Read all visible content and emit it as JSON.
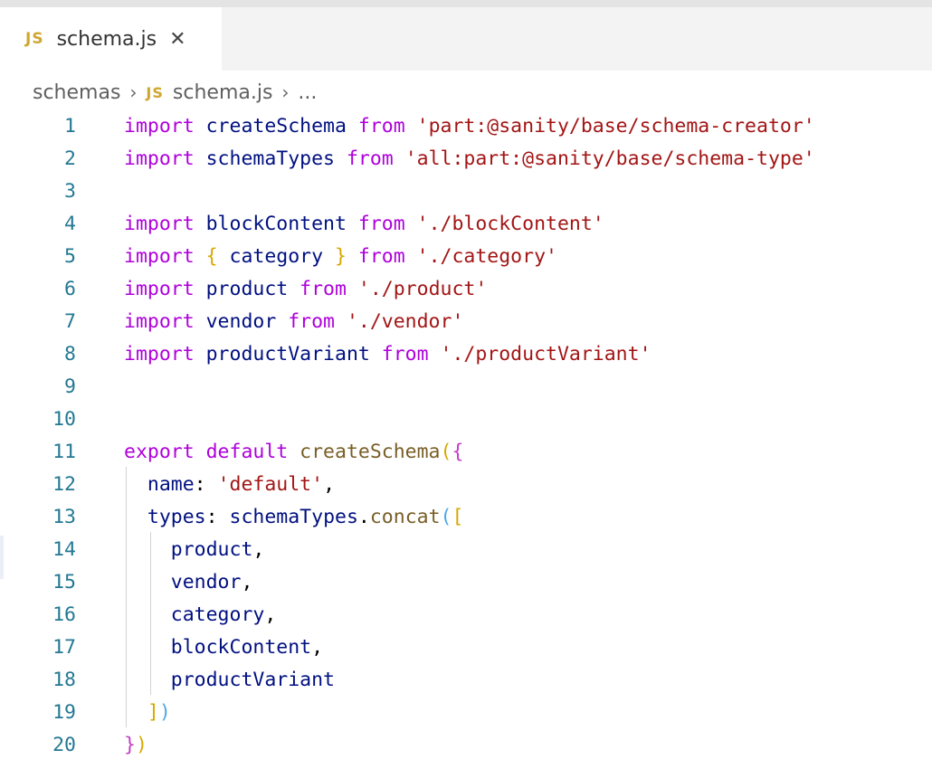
{
  "tab": {
    "badge": "JS",
    "filename": "schema.js",
    "close": "✕"
  },
  "breadcrumb": {
    "folder": "schemas",
    "sep1": "›",
    "badge": "JS",
    "file": "schema.js",
    "sep2": "›",
    "more": "..."
  },
  "lines": [
    {
      "n": "1",
      "t": [
        [
          "kw",
          "import "
        ],
        [
          "id",
          "createSchema "
        ],
        [
          "kw",
          "from "
        ],
        [
          "str",
          "'part:@sanity/base/schema-creator'"
        ]
      ]
    },
    {
      "n": "2",
      "t": [
        [
          "kw",
          "import "
        ],
        [
          "id",
          "schemaTypes "
        ],
        [
          "kw",
          "from "
        ],
        [
          "str",
          "'all:part:@sanity/base/schema-type'"
        ]
      ]
    },
    {
      "n": "3",
      "t": []
    },
    {
      "n": "4",
      "t": [
        [
          "kw",
          "import "
        ],
        [
          "id",
          "blockContent "
        ],
        [
          "kw",
          "from "
        ],
        [
          "str",
          "'./blockContent'"
        ]
      ]
    },
    {
      "n": "5",
      "t": [
        [
          "kw",
          "import "
        ],
        [
          "b1",
          "{ "
        ],
        [
          "id",
          "category "
        ],
        [
          "b1",
          "} "
        ],
        [
          "kw",
          "from "
        ],
        [
          "str",
          "'./category'"
        ]
      ]
    },
    {
      "n": "6",
      "t": [
        [
          "kw",
          "import "
        ],
        [
          "id",
          "product "
        ],
        [
          "kw",
          "from "
        ],
        [
          "str",
          "'./product'"
        ]
      ]
    },
    {
      "n": "7",
      "t": [
        [
          "kw",
          "import "
        ],
        [
          "id",
          "vendor "
        ],
        [
          "kw",
          "from "
        ],
        [
          "str",
          "'./vendor'"
        ]
      ]
    },
    {
      "n": "8",
      "t": [
        [
          "kw",
          "import "
        ],
        [
          "id",
          "productVariant "
        ],
        [
          "kw",
          "from "
        ],
        [
          "str",
          "'./productVariant'"
        ]
      ]
    },
    {
      "n": "9",
      "t": []
    },
    {
      "n": "10",
      "t": []
    },
    {
      "n": "11",
      "t": [
        [
          "kw",
          "export default "
        ],
        [
          "fn",
          "createSchema"
        ],
        [
          "b1",
          "("
        ],
        [
          "b2",
          "{"
        ]
      ]
    },
    {
      "n": "12",
      "t": [
        [
          "df",
          "  "
        ],
        [
          "id",
          "name"
        ],
        [
          "df",
          ": "
        ],
        [
          "str",
          "'default'"
        ],
        [
          "df",
          ","
        ]
      ]
    },
    {
      "n": "13",
      "t": [
        [
          "df",
          "  "
        ],
        [
          "id",
          "types"
        ],
        [
          "df",
          ": "
        ],
        [
          "id",
          "schemaTypes"
        ],
        [
          "df",
          "."
        ],
        [
          "fn",
          "concat"
        ],
        [
          "b3",
          "("
        ],
        [
          "b1",
          "["
        ]
      ]
    },
    {
      "n": "14",
      "t": [
        [
          "df",
          "    "
        ],
        [
          "id",
          "product"
        ],
        [
          "df",
          ","
        ]
      ]
    },
    {
      "n": "15",
      "t": [
        [
          "df",
          "    "
        ],
        [
          "id",
          "vendor"
        ],
        [
          "df",
          ","
        ]
      ]
    },
    {
      "n": "16",
      "t": [
        [
          "df",
          "    "
        ],
        [
          "id",
          "category"
        ],
        [
          "df",
          ","
        ]
      ]
    },
    {
      "n": "17",
      "t": [
        [
          "df",
          "    "
        ],
        [
          "id",
          "blockContent"
        ],
        [
          "df",
          ","
        ]
      ]
    },
    {
      "n": "18",
      "t": [
        [
          "df",
          "    "
        ],
        [
          "id",
          "productVariant"
        ]
      ]
    },
    {
      "n": "19",
      "t": [
        [
          "df",
          "  "
        ],
        [
          "b1",
          "]"
        ],
        [
          "b3",
          ")"
        ]
      ]
    },
    {
      "n": "20",
      "t": [
        [
          "b2",
          "}"
        ],
        [
          "b1",
          ")"
        ]
      ]
    }
  ]
}
